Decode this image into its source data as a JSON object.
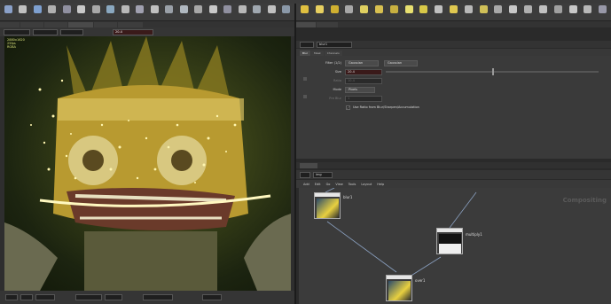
{
  "viewport": {
    "header_field_value": "20.4",
    "info_lines": [
      "2880x1620",
      "25fps",
      "RGBA"
    ]
  },
  "params": {
    "path": "blur1",
    "tabs": [
      "Blur",
      "Mask",
      "Channels"
    ],
    "size_value": "20.4",
    "filter_type_label": "Filter (1/2)",
    "filter_type_value": "Gaussian",
    "filter_type_value2": "Gaussian",
    "size_label": "Size",
    "size_slider": 0.5,
    "ratio_label": "Ratio",
    "ratio_value": "10.4",
    "mode_label": "Mode",
    "mode_value": "Pixels",
    "preblur_label": "Pre Blur",
    "preblur_value": "1",
    "checkbox_label": "Use Ratio from Blur/Sharpen/Accumulation",
    "checkbox_checked": true
  },
  "network": {
    "path": "img",
    "menu_items": [
      "Add",
      "Edit",
      "Go",
      "View",
      "Tools",
      "Layout",
      "Help"
    ],
    "watermark": "Compositing",
    "nodes": [
      {
        "name": "blur1"
      },
      {
        "name": "multiply1"
      },
      {
        "name": "over1"
      }
    ]
  },
  "colors": {
    "node_border": "#aaaaaa",
    "param_active": "#3a1a1a"
  }
}
